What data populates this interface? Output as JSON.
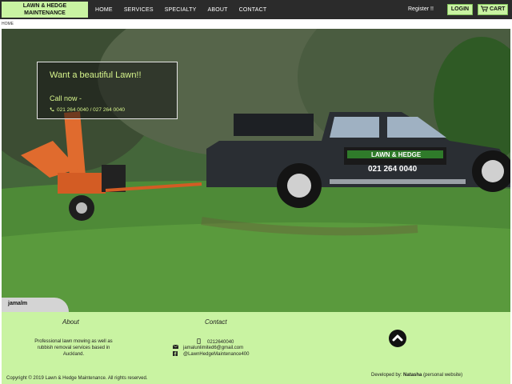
{
  "brand": {
    "line1": "LAWN & HEDGE",
    "line2": "MAINTENANCE"
  },
  "nav": {
    "items": [
      "HOME",
      "SERVICES",
      "SPECIALTY",
      "ABOUT",
      "CONTACT"
    ]
  },
  "header_right": {
    "register": "Register !!",
    "login": "LOGIN",
    "cart": "CART"
  },
  "breadcrumb": "HOME",
  "hero": {
    "title": "Want a beautiful Lawn!!",
    "call": "Call now -",
    "phone": "021 264 0040 / 027 264 0040",
    "truck_logo": "LAWN & HEDGE",
    "truck_phone": "021 264 0040",
    "tag": "jamalm"
  },
  "footer": {
    "about_heading": "About",
    "about_text": "Professional lawn mowing as well as rubbish removal services based in Auckland.",
    "contact_heading": "Contact",
    "phone": "0212640040",
    "email": "jamalunlimited6@gmail.com",
    "facebook": "@LawnHedgeMaintenance400",
    "copyright": "Copyright © 2019 Lawn & Hedge Maintenance. All rights reserved.",
    "developed_by": "Developed by:",
    "developer": "Natasha",
    "developer_link": "(personal website)"
  },
  "colors": {
    "accent": "#c9f3a2",
    "topbar": "#2b2b2b",
    "promo_text": "#d7f58c"
  },
  "icons": [
    "cart-icon",
    "phone-icon",
    "mobile-icon",
    "email-icon",
    "facebook-icon",
    "chevron-up-icon"
  ]
}
